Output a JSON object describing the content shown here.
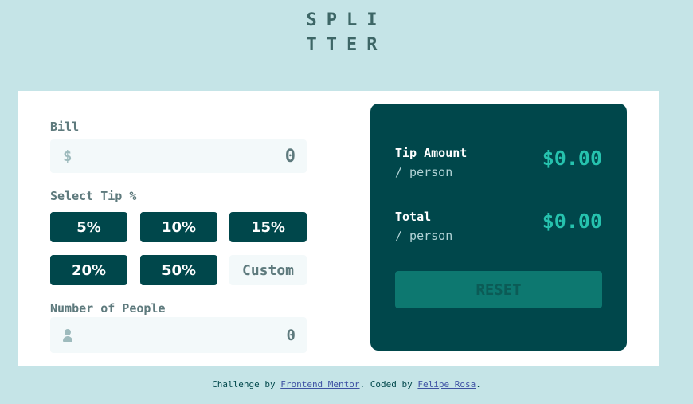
{
  "logo": {
    "line1": "SPLI",
    "line2": "TTER"
  },
  "bill": {
    "label": "Bill",
    "currency_icon": "dollar-icon",
    "currency_symbol": "$",
    "value": "0"
  },
  "tip": {
    "label": "Select Tip %",
    "options": [
      "5%",
      "10%",
      "15%",
      "20%",
      "50%"
    ],
    "custom_placeholder": "Custom"
  },
  "people": {
    "label": "Number of People",
    "icon": "person-icon",
    "value": "0"
  },
  "result": {
    "tip_amount_label": "Tip Amount",
    "tip_amount_sub": "/ person",
    "tip_amount_value": "$0.00",
    "total_label": "Total",
    "total_sub": "/ person",
    "total_value": "$0.00",
    "reset_label": "RESET"
  },
  "footer": {
    "prefix": "Challenge by ",
    "link1": "Frontend Mentor",
    "middle": ". Coded by ",
    "link2": "Felipe Rosa",
    "suffix": "."
  },
  "colors": {
    "background": "#c5e4e7",
    "dark_cyan": "#00474b",
    "strong_cyan": "#26c2ae",
    "input_bg": "#f3f9fa"
  }
}
